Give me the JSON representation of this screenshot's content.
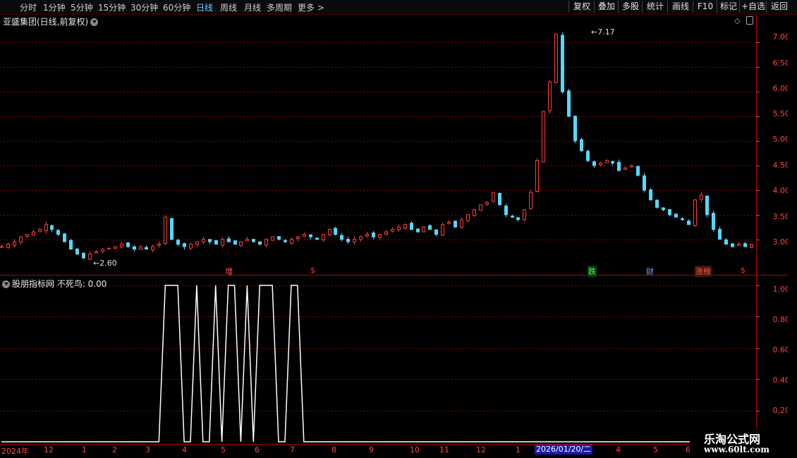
{
  "toolbar": {
    "periods": [
      "分时",
      "1分钟",
      "5分钟",
      "15分钟",
      "30分钟",
      "60分钟",
      "日线",
      "周线",
      "月线",
      "多周期",
      "更多 >"
    ],
    "active_period": "日线",
    "buttons": [
      "复权",
      "叠加",
      "多股",
      "统计",
      "画线",
      "F10",
      "标记",
      "+自选",
      "返回"
    ]
  },
  "main_pane": {
    "title": "亚盛集团(日线,前复权)",
    "high_label": "7.17",
    "low_label": "2.60",
    "y_ticks": [
      "7.00",
      "6.50",
      "6.00",
      "5.50",
      "5.00",
      "4.50",
      "4.00",
      "3.50",
      "3.00"
    ],
    "signals": [
      {
        "text": "增",
        "color": "#ff5555"
      },
      {
        "text": "$",
        "color": "#ff3333"
      },
      {
        "text": "跌",
        "color": "#44ff44"
      },
      {
        "text": "财",
        "color": "#66aaff"
      },
      {
        "text": "涨榜",
        "color": "#ff5555"
      },
      {
        "text": "$",
        "color": "#ff3333"
      }
    ]
  },
  "indicator_pane": {
    "title": "股朋指标网 不死鸟: 0.00",
    "y_ticks": [
      "1.00",
      "0.80",
      "0.60",
      "0.40",
      "0.20"
    ]
  },
  "x_axis": {
    "labels": [
      "2024年",
      "12",
      "1",
      "2",
      "3",
      "4",
      "5",
      "6",
      "7",
      "8",
      "9",
      "10",
      "11",
      "12",
      "1",
      "4",
      "5",
      "6"
    ],
    "cursor_date": "2026/01/20/二"
  },
  "watermark": {
    "title": "乐淘公式网",
    "url": "www.60lt.com"
  },
  "colors": {
    "up": "#ff3c3c",
    "down": "#54d8ff",
    "grid": "#8a0000",
    "axis": "#ff4444",
    "line": "#ffffff"
  },
  "chart_data": [
    {
      "type": "candlestick",
      "title": "亚盛集团(日线,前复权)",
      "ylim": [
        2.45,
        7.35
      ],
      "annotations": [
        {
          "label": "7.17",
          "kind": "high"
        },
        {
          "label": "2.60",
          "kind": "low"
        }
      ],
      "series": [
        {
          "values": [
            2.85,
            2.9,
            2.95,
            3.05,
            3.1,
            3.15,
            3.2,
            3.3,
            3.2,
            3.1,
            2.95,
            2.8,
            2.7,
            2.62,
            2.7,
            2.75,
            2.8,
            2.82,
            2.85,
            2.9,
            2.85,
            2.8,
            2.85,
            2.8,
            2.85,
            2.9,
            3.45,
            3.0,
            2.9,
            2.85,
            2.9,
            2.95,
            3.0,
            2.95,
            2.9,
            3.0,
            2.95,
            2.9,
            2.95,
            3.0,
            2.95,
            2.9,
            3.0,
            3.05,
            3.0,
            2.95,
            3.0,
            3.05,
            3.1,
            3.05,
            3.0,
            3.1,
            3.2,
            3.1,
            3.0,
            2.95,
            3.0,
            3.05,
            3.1,
            3.05,
            3.1,
            3.15,
            3.2,
            3.25,
            3.3,
            3.2,
            3.15,
            3.25,
            3.2,
            3.1,
            3.3,
            3.35,
            3.25,
            3.4,
            3.5,
            3.6,
            3.7,
            3.75,
            3.95,
            3.7,
            3.5,
            3.45,
            3.4,
            3.6,
            3.95,
            4.6,
            5.6,
            6.2,
            7.17,
            6.0,
            5.5,
            5.0,
            4.8,
            4.6,
            4.5,
            4.55,
            4.6,
            4.55,
            4.4,
            4.45,
            4.5,
            4.3,
            4.0,
            3.8,
            3.65,
            3.6,
            3.5,
            3.45,
            3.4,
            3.3,
            3.8,
            3.9,
            3.5,
            3.2,
            3.0,
            2.9,
            2.85,
            2.9,
            2.85,
            2.9
          ]
        }
      ]
    },
    {
      "type": "line",
      "title": "股朋指标网 不死鸟: 0.00",
      "ylim": [
        0,
        1
      ],
      "series": [
        {
          "values": [
            0,
            0,
            0,
            0,
            0,
            0,
            0,
            0,
            0,
            0,
            0,
            0,
            0,
            0,
            0,
            0,
            0,
            0,
            0,
            0,
            0,
            0,
            0,
            0,
            0,
            0,
            1,
            1,
            1,
            0,
            0,
            1,
            0,
            0,
            1,
            0,
            1,
            1,
            0,
            1,
            0,
            1,
            1,
            1,
            0,
            0,
            1,
            1,
            0,
            0,
            0,
            0,
            0,
            0,
            0,
            0,
            0,
            0,
            0,
            0,
            0,
            0,
            0,
            0,
            0,
            0,
            0,
            0,
            0,
            0,
            0,
            0,
            0,
            0,
            0,
            0,
            0,
            0,
            0,
            0,
            0,
            0,
            0,
            0,
            0,
            0,
            0,
            0,
            0,
            0,
            0,
            0,
            0,
            0,
            0,
            0,
            0,
            0,
            0,
            0,
            0,
            0,
            0,
            0,
            0,
            0,
            0,
            0,
            0,
            0,
            0,
            0,
            0,
            0,
            0,
            0,
            0,
            0,
            0,
            0
          ]
        }
      ]
    }
  ]
}
